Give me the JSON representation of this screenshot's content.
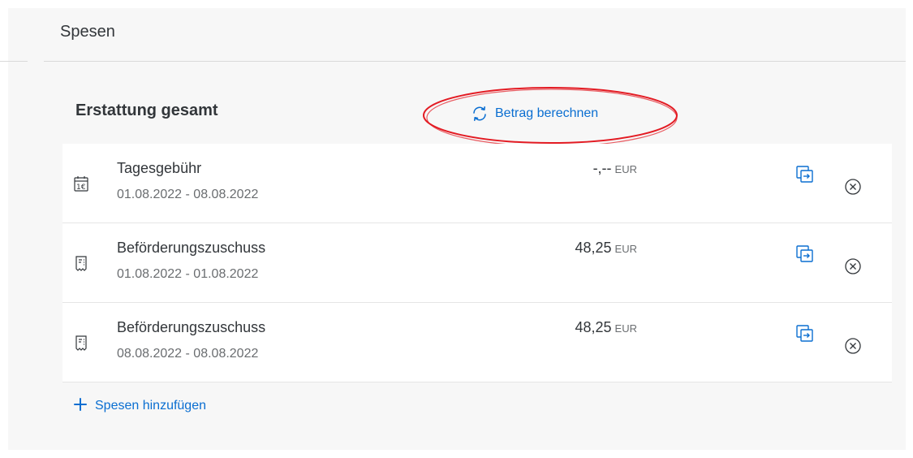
{
  "header": {
    "title": "Spesen"
  },
  "summary": {
    "title": "Erstattung gesamt",
    "calculate_label": "Betrag berechnen",
    "calculate_icon": "refresh-icon"
  },
  "expenses": [
    {
      "icon": "calendar-euro-icon",
      "name": "Tagesgebühr",
      "date_range": "01.08.2022 - 08.08.2022",
      "amount": "-,--",
      "currency": "EUR"
    },
    {
      "icon": "receipt-icon",
      "name": "Beförderungszuschuss",
      "date_range": "01.08.2022 - 01.08.2022",
      "amount": "48,25",
      "currency": "EUR"
    },
    {
      "icon": "receipt-icon",
      "name": "Beförderungszuschuss",
      "date_range": "08.08.2022 - 08.08.2022",
      "amount": "48,25",
      "currency": "EUR"
    }
  ],
  "actions": {
    "add_label": "Spesen hinzufügen",
    "copy_icon": "copy-icon",
    "delete_icon": "delete-circle-icon"
  },
  "colors": {
    "accent": "#0a6ed1",
    "text": "#32363a",
    "secondary_text": "#6a6d70",
    "annotation": "#e31b23",
    "background": "#f7f7f7"
  }
}
